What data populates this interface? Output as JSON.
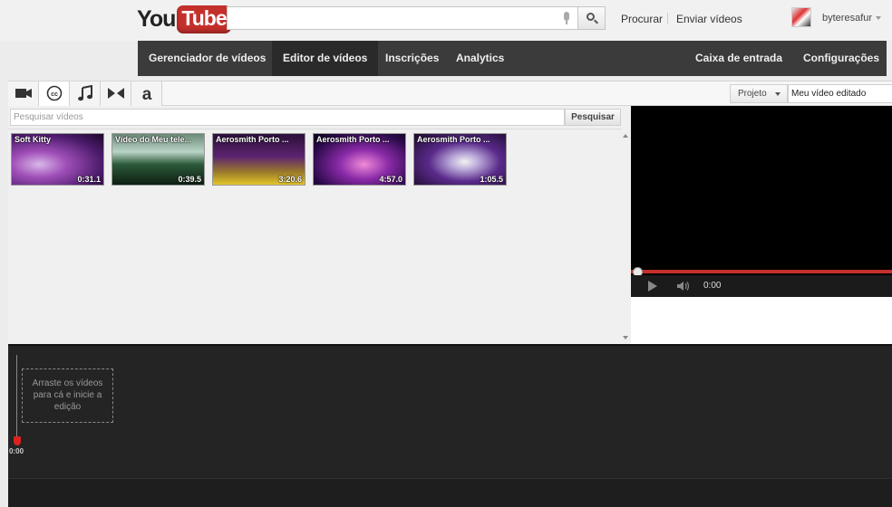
{
  "header": {
    "logo_you": "You",
    "logo_tube": "Tube",
    "search_value": "",
    "links": {
      "browse": "Procurar",
      "upload": "Enviar vídeos"
    },
    "username": "byteresafur"
  },
  "nav": {
    "left": [
      "Gerenciador de vídeos",
      "Editor de vídeos",
      "Inscrições",
      "Analytics"
    ],
    "active": "Editor de vídeos",
    "right": [
      "Caixa de entrada",
      "Configurações"
    ]
  },
  "toolbar": {
    "tools": [
      "video-camera-icon",
      "cc-icon",
      "music-note-icon",
      "transitions-icon",
      "text-a-icon"
    ],
    "project_label": "Projeto",
    "project_name": "Meu vídeo editado"
  },
  "library": {
    "search_placeholder": "Pesquisar vídeos",
    "search_button": "Pesquisar",
    "videos": [
      {
        "title": "Soft Kitty",
        "duration": "0:31.1"
      },
      {
        "title": "Vídeo do Meu tele...",
        "duration": "0:39.5"
      },
      {
        "title": "Aerosmith Porto ...",
        "duration": "3:20.6"
      },
      {
        "title": "Aerosmith Porto ...",
        "duration": "4:57.0"
      },
      {
        "title": "Aerosmith Porto ...",
        "duration": "1:05.5"
      }
    ]
  },
  "player": {
    "time": "0:00",
    "progress": 0
  },
  "timeline": {
    "playhead_time": "0:00",
    "drop_hint": "Arraste os vídeos para cá e inicie a edição"
  },
  "colors": {
    "brand_red": "#c4302b",
    "nav_bg": "#3b3b3b",
    "timeline_bg": "#242424"
  }
}
